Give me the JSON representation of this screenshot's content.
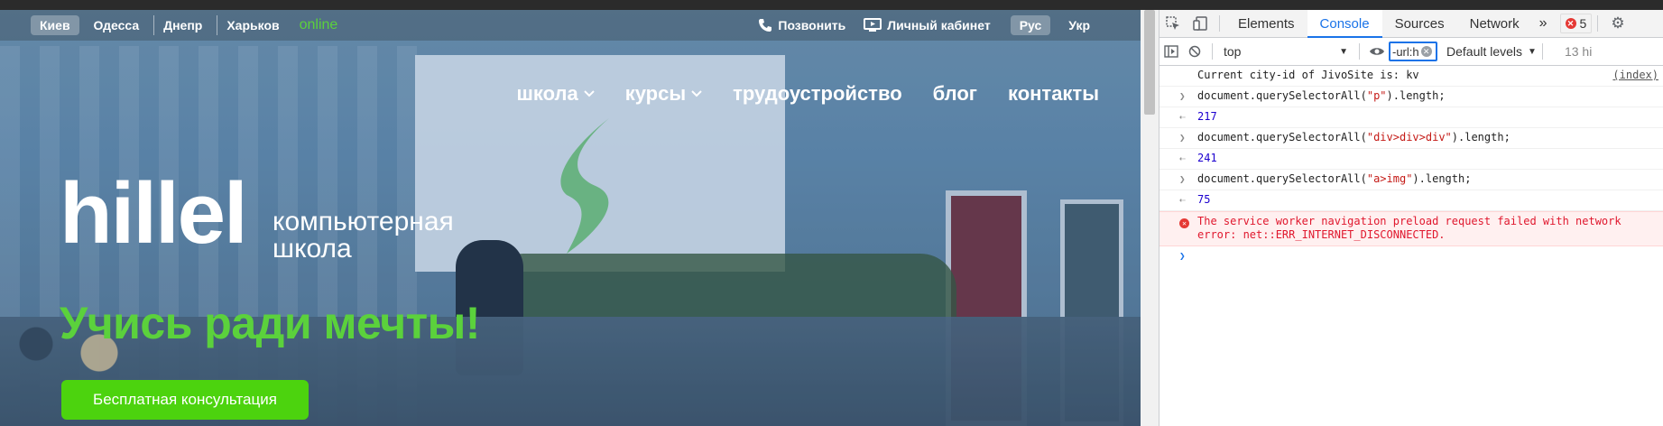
{
  "site": {
    "cities": [
      "Киев",
      "Одесса",
      "Днепр",
      "Харьков"
    ],
    "active_city": "Киев",
    "online_label": "online",
    "call_label": "Позвонить",
    "cabinet_label": "Личный кабинет",
    "langs": [
      "Рус",
      "Укр"
    ],
    "menu": {
      "school": "школа",
      "courses": "курсы",
      "jobs": "трудоустройство",
      "blog": "блог",
      "contacts": "контакты"
    },
    "logo_word": "hillel",
    "logo_sub_1": "компьютерная",
    "logo_sub_2": "школа",
    "tagline": "Учись ради мечты!",
    "cta_label": "Бесплатная консультация",
    "colors": {
      "brand_green": "#5bd13c",
      "cta_green": "#4cd30e"
    }
  },
  "devtools": {
    "tabs": [
      "Elements",
      "Console",
      "Sources",
      "Network"
    ],
    "active_tab": "Console",
    "more_label": "»",
    "error_count": "5",
    "context": "top",
    "filter_value": "-url:h",
    "levels_label": "Default levels",
    "hidden_label": "13 hi",
    "lines": [
      {
        "type": "log",
        "text": "Current city-id of JivoSite is: kv",
        "source": "(index)"
      },
      {
        "type": "input",
        "pre": "document.querySelectorAll(",
        "str": "\"p\"",
        "post": ").length;"
      },
      {
        "type": "result",
        "value": "217"
      },
      {
        "type": "input",
        "pre": "document.querySelectorAll(",
        "str": "\"div>div>div\"",
        "post": ").length;"
      },
      {
        "type": "result",
        "value": "241"
      },
      {
        "type": "input",
        "pre": "document.querySelectorAll(",
        "str": "\"a>img\"",
        "post": ").length;"
      },
      {
        "type": "result",
        "value": "75"
      },
      {
        "type": "error",
        "text1": "The service worker navigation preload request failed with network",
        "text2": "error: net::ERR_INTERNET_DISCONNECTED."
      }
    ]
  }
}
